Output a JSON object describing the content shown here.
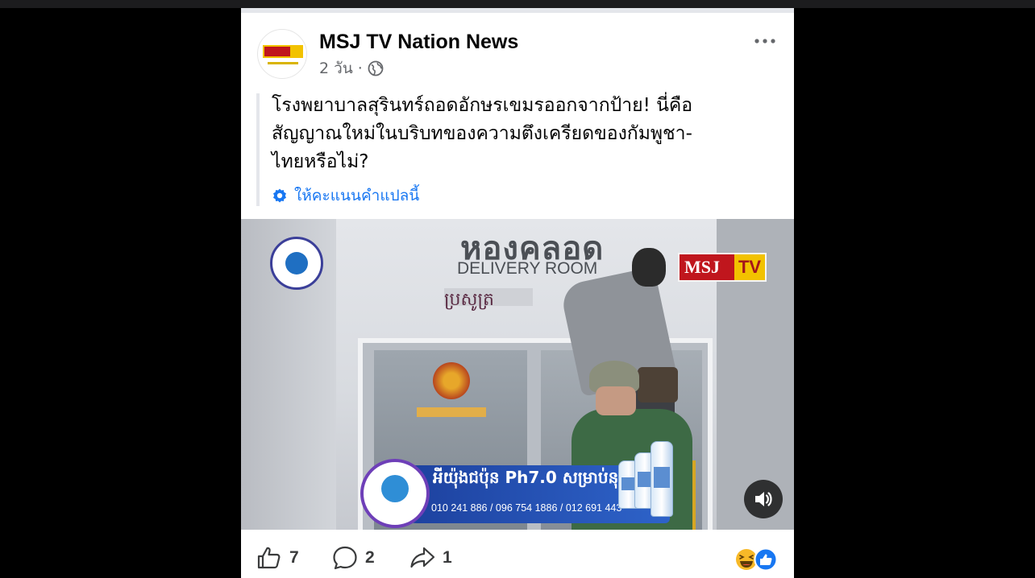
{
  "post": {
    "page_name": "MSJ TV Nation News",
    "time": "2 วัน",
    "separator": "·",
    "privacy_icon": "globe-icon",
    "more_icon": "more-options-icon",
    "avatar_logo_text": "MSJTV",
    "text_lines": [
      "โรงพยาบาลสุรินทร์ถอดอักษรเขมรออกจากป้าย! นี่คือ",
      "สัญญาณใหม่ในบริบทของความตึงเครียดของกัมพูชา-",
      "ไทยหรือไม่?"
    ],
    "translate_label": "ให้คะแนนคำแปลนี้"
  },
  "video": {
    "sign_thai": "หองคลอด",
    "sign_english": "DELIVERY ROOM",
    "sign_khmer": "ប្រសូត្រ",
    "watermark": {
      "msj": "MSJ",
      "tv": "TV"
    },
    "ad_khmer": "អីយ៉ុងជប៉ុន Ph7.0 សម្រាប់នុងជុំ",
    "ad_phone": "010 241 886 / 096 754 1886 / 012 691 443",
    "sound_icon": "speaker-icon"
  },
  "actions": {
    "likes": "7",
    "comments": "2",
    "shares": "1",
    "reaction_icons": [
      "haha-icon",
      "like-icon"
    ]
  },
  "colors": {
    "accent": "#1877f2",
    "text": "#050505",
    "secondary": "#65676b",
    "brand_red": "#c0161d",
    "brand_yellow": "#f2c200"
  }
}
